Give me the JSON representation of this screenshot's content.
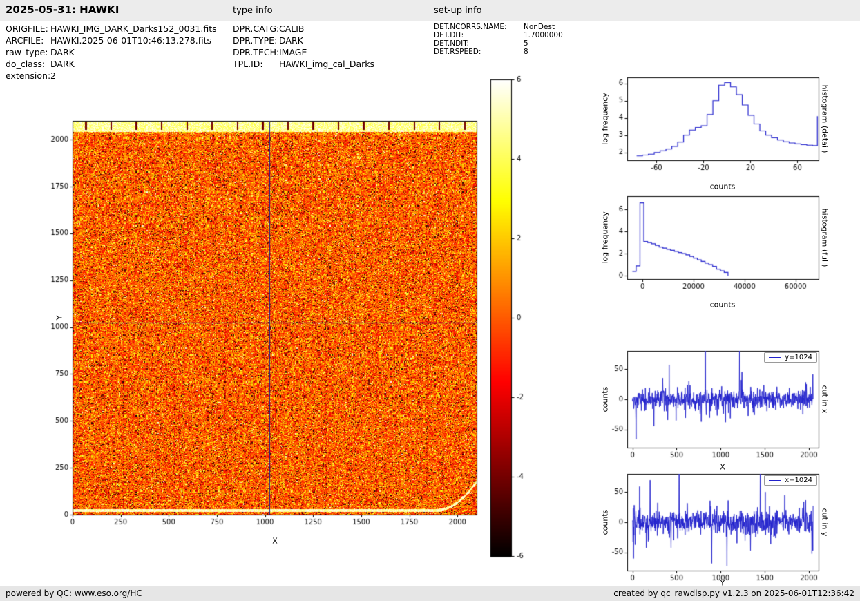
{
  "header": {
    "title": "2025-05-31: HAWKI",
    "type_info": "type info",
    "setup_info": "set-up info"
  },
  "file_info": {
    "left": [
      {
        "label": "ORIGFILE:",
        "value": "HAWKI_IMG_DARK_Darks152_0031.fits"
      },
      {
        "label": "ARCFILE:",
        "value": "HAWKI.2025-06-01T10:46:13.278.fits"
      },
      {
        "label": "raw_type:",
        "value": "DARK"
      },
      {
        "label": "do_class:",
        "value": "DARK"
      },
      {
        "label": "extension:",
        "value": "2"
      }
    ],
    "type": [
      {
        "label": "DPR.CATG:",
        "value": "CALIB"
      },
      {
        "label": "DPR.TYPE:",
        "value": "DARK"
      },
      {
        "label": "DPR.TECH:",
        "value": "IMAGE"
      },
      {
        "label": "TPL.ID:",
        "value": "HAWKI_img_cal_Darks"
      }
    ],
    "setup": [
      {
        "label": "DET.NCORRS.NAME:",
        "value": "NonDest"
      },
      {
        "label": "DET.DIT:",
        "value": "1.7000000"
      },
      {
        "label": "DET.NDIT:",
        "value": "5"
      },
      {
        "label": "DET.RSPEED:",
        "value": "8"
      }
    ]
  },
  "footer": {
    "left": "powered by QC: www.eso.org/HC",
    "right": "created by qc_rawdisp.py v1.2.3 on 2025-06-01T12:36:42"
  },
  "colors": {
    "line": "#2222cc",
    "crosshair": "#1a1a8c",
    "header_bg": "#ececec",
    "footer_bg": "#e6e6e6"
  },
  "chart_data": [
    {
      "id": "main-image",
      "type": "heatmap",
      "xlabel": "X",
      "ylabel": "Y",
      "xlim": [
        0,
        2100
      ],
      "ylim": [
        0,
        2100
      ],
      "xticks": [
        0,
        250,
        500,
        750,
        1000,
        1250,
        1500,
        1750,
        2000
      ],
      "yticks": [
        0,
        250,
        500,
        750,
        1000,
        1250,
        1500,
        1750,
        2000
      ],
      "colormap": "hot",
      "value_range": [
        -6,
        6
      ],
      "crosshair": {
        "x": 1024,
        "y": 1024
      },
      "noise_sigma": 1.4,
      "seed": 12345,
      "features": {
        "bright_top_band": true,
        "dark_ref_ticks_spacing_px": 128,
        "bright_bottom_row": true,
        "bottom_row_curls_up_at_right": true
      }
    },
    {
      "id": "colorbar",
      "type": "colorbar",
      "ticks": [
        6,
        4,
        2,
        0,
        -2,
        -4,
        -6
      ],
      "vmin": -6,
      "vmax": 6,
      "colormap": "hot"
    },
    {
      "id": "hist-detail",
      "type": "line",
      "xlabel": "counts",
      "ylabel": "log frequency",
      "side_label": "histogram (detail)",
      "xlim": [
        -85,
        78
      ],
      "ylim": [
        1.55,
        6.35
      ],
      "xticks": [
        -60,
        -20,
        20,
        60
      ],
      "yticks": [
        2,
        3,
        4,
        5,
        6
      ],
      "x": [
        -77,
        -72,
        -67,
        -62,
        -57,
        -52,
        -47,
        -42,
        -37,
        -32,
        -27,
        -22,
        -17,
        -12,
        -7,
        -2,
        3,
        8,
        13,
        18,
        23,
        28,
        33,
        38,
        43,
        48,
        53,
        58,
        63,
        68,
        73,
        77
      ],
      "y": [
        1.8,
        1.85,
        1.9,
        2.0,
        2.1,
        2.2,
        2.35,
        2.6,
        3.0,
        3.3,
        3.45,
        3.55,
        4.2,
        5.0,
        5.9,
        6.05,
        5.8,
        5.35,
        4.75,
        4.15,
        3.65,
        3.25,
        3.0,
        2.85,
        2.72,
        2.62,
        2.55,
        2.5,
        2.45,
        2.42,
        2.4,
        4.1
      ]
    },
    {
      "id": "hist-full",
      "type": "line",
      "xlabel": "counts",
      "ylabel": "log frequency",
      "side_label": "histogram (full)",
      "xlim": [
        -6000,
        69000
      ],
      "ylim": [
        -0.3,
        7.2
      ],
      "xticks": [
        0,
        20000,
        40000,
        60000
      ],
      "yticks": [
        0,
        2,
        4,
        6
      ],
      "x": [
        -4000,
        -2500,
        -1000,
        500,
        2000,
        3500,
        5000,
        6500,
        8000,
        9500,
        11000,
        12500,
        14000,
        15500,
        17000,
        18500,
        20000,
        21500,
        23000,
        24500,
        26000,
        27500,
        29000,
        30500,
        32000,
        33500
      ],
      "y": [
        0.4,
        0.9,
        6.6,
        3.1,
        3.0,
        2.9,
        2.75,
        2.6,
        2.5,
        2.4,
        2.3,
        2.2,
        2.1,
        2.0,
        1.9,
        1.75,
        1.6,
        1.45,
        1.3,
        1.15,
        1.0,
        0.85,
        0.6,
        0.45,
        0.3,
        0.0
      ]
    },
    {
      "id": "cut-x",
      "type": "line",
      "xlabel": "X",
      "ylabel": "counts",
      "side_label": "cut in x",
      "legend": "y=1024",
      "xlim": [
        -60,
        2110
      ],
      "ylim": [
        -80,
        80
      ],
      "xticks": [
        0,
        500,
        1000,
        1500,
        2000
      ],
      "yticks": [
        -50,
        0,
        50
      ],
      "noise": {
        "seed": 1234,
        "sigma": 8,
        "n": 760,
        "x_max": 2048,
        "tail_p": 0.06
      },
      "spikes": [
        {
          "x": 40,
          "v": -66
        },
        {
          "x": 415,
          "v": 57
        },
        {
          "x": 640,
          "v": 30
        },
        {
          "x": 825,
          "v": 120
        },
        {
          "x": 1055,
          "v": -38
        },
        {
          "x": 1215,
          "v": 120
        },
        {
          "x": 1240,
          "v": 45
        },
        {
          "x": 1965,
          "v": 28
        }
      ]
    },
    {
      "id": "cut-y",
      "type": "line",
      "xlabel": "Y",
      "ylabel": "counts",
      "side_label": "cut in y",
      "legend": "x=1024",
      "xlim": [
        -60,
        2110
      ],
      "ylim": [
        -80,
        80
      ],
      "xticks": [
        0,
        500,
        1000,
        1500,
        2000
      ],
      "yticks": [
        -50,
        0,
        50
      ],
      "noise": {
        "seed": 999,
        "sigma": 10,
        "n": 760,
        "x_max": 2048,
        "tail_p": 0.08
      },
      "spikes": [
        {
          "x": 12,
          "v": -60
        },
        {
          "x": 530,
          "v": 120
        },
        {
          "x": 1085,
          "v": 36
        },
        {
          "x": 1450,
          "v": 120
        },
        {
          "x": 1505,
          "v": 50
        },
        {
          "x": 2035,
          "v": -52
        }
      ]
    }
  ]
}
